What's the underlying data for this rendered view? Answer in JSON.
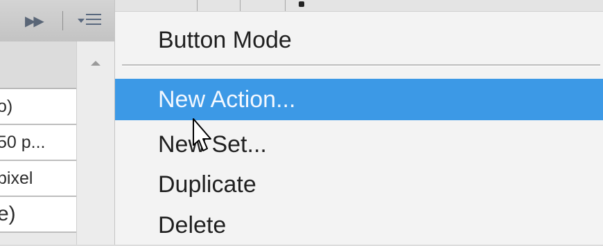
{
  "panel": {
    "rows": [
      {
        "text": "o)"
      },
      {
        "text": "50 p..."
      },
      {
        "text": "pixel"
      },
      {
        "text": "e)"
      }
    ]
  },
  "menu": {
    "items": [
      {
        "label": "Button Mode"
      },
      {
        "label": "New Action..."
      },
      {
        "label": "New Set..."
      },
      {
        "label": "Duplicate"
      },
      {
        "label": "Delete"
      }
    ],
    "highlight_color": "#3c99e6"
  },
  "icons": [
    "fast-forward-icon",
    "panel-menu-icon",
    "scroll-up-arrow-icon",
    "mouse-cursor-icon"
  ]
}
